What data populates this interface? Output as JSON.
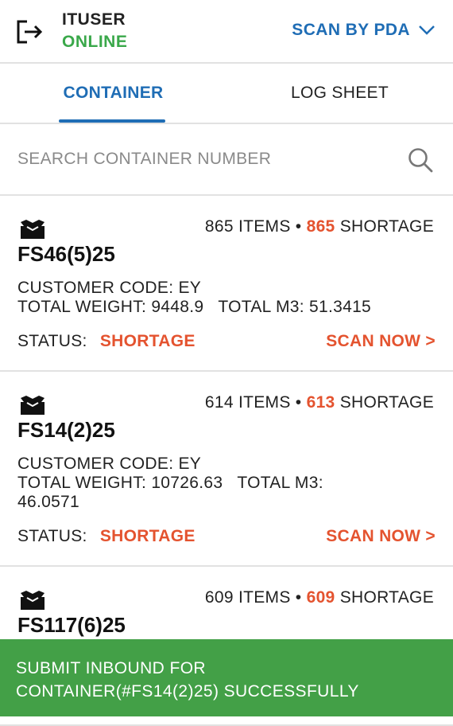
{
  "header": {
    "user_name": "ITUSER",
    "user_status": "ONLINE",
    "scan_mode": "SCAN BY PDA",
    "icons": {
      "logout": "logout-icon",
      "dropdown": "chevron-down-icon"
    }
  },
  "tabs": [
    {
      "label": "CONTAINER",
      "active": true
    },
    {
      "label": "LOG SHEET",
      "active": false
    }
  ],
  "search": {
    "placeholder": "SEARCH CONTAINER NUMBER",
    "value": "",
    "icon": "search-icon"
  },
  "containers": [
    {
      "items": "865 ITEMS",
      "separator": "•",
      "shortage_count": "865",
      "shortage_label": "SHORTAGE",
      "number": "FS46(5)25",
      "customer_code": "CUSTOMER CODE: EY",
      "weight_line": "TOTAL WEIGHT: 9448.9   TOTAL M3: 51.3415",
      "status_label": "STATUS:",
      "status_value": "SHORTAGE",
      "action": "SCAN NOW >"
    },
    {
      "items": "614 ITEMS",
      "separator": "•",
      "shortage_count": "613",
      "shortage_label": "SHORTAGE",
      "number": "FS14(2)25",
      "customer_code": "CUSTOMER CODE: EY",
      "weight_line": "TOTAL WEIGHT: 10726.63   TOTAL M3:",
      "weight_line_2": "46.0571",
      "status_label": "STATUS:",
      "status_value": "SHORTAGE",
      "action": "SCAN NOW >"
    },
    {
      "items": "609 ITEMS",
      "separator": "•",
      "shortage_count": "609",
      "shortage_label": "SHORTAGE",
      "number": "FS117(6)25"
    }
  ],
  "toast": {
    "line1": "SUBMIT INBOUND FOR",
    "line2": "CONTAINER(#FS14(2)25) SUCCESSFULLY"
  },
  "colors": {
    "primary_blue": "#1f6db5",
    "online_green": "#3aa84a",
    "shortage_orange": "#e4532f",
    "toast_green": "#43a047"
  }
}
